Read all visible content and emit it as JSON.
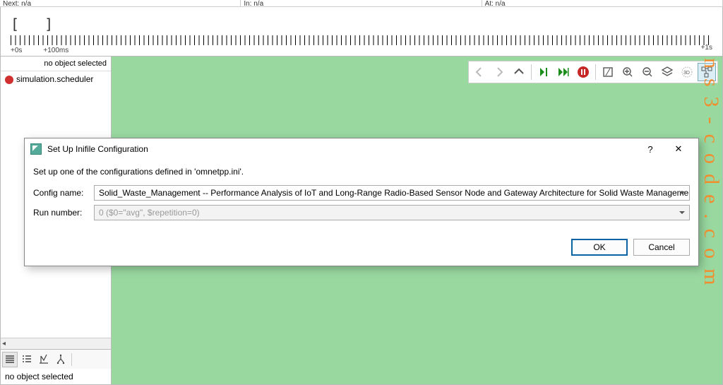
{
  "top_strip": {
    "c0": "Next: n/a",
    "c1": "In: n/a",
    "c2": "At: n/a"
  },
  "timeline": {
    "start": "+0s",
    "tick100": "+100ms",
    "end": "+1s"
  },
  "left_top": "no object selected",
  "tree_item": "simulation.scheduler",
  "left_bottom_text": "no object selected",
  "dialog": {
    "title": "Set Up Inifile Configuration",
    "desc": "Set up one of the configurations defined in 'omnetpp.ini'.",
    "config_label": "Config name:",
    "config_value": "Solid_Waste_Management -- Performance Analysis of IoT and Long-Range Radio-Based Sensor Node and Gateway Architecture for Solid Waste Management",
    "run_label": "Run number:",
    "run_value": "0 ($0=\"avg\", $repetition=0)",
    "ok": "OK",
    "cancel": "Cancel",
    "help": "?",
    "close": "✕"
  },
  "watermark": "ns3-code.com"
}
